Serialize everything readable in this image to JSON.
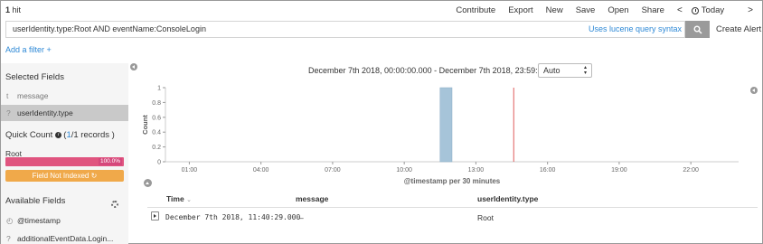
{
  "topbar": {
    "hit_count": "1",
    "hit_label": "hit",
    "menu": [
      "Contribute",
      "Export",
      "New",
      "Save",
      "Open",
      "Share"
    ],
    "nav_prev": "<",
    "today": "Today",
    "nav_next": ">"
  },
  "search": {
    "query": "userIdentity.type:Root AND eventName:ConsoleLogin",
    "lucene_link": "Uses lucene query syntax",
    "create_alert": "Create Alert"
  },
  "filters": {
    "add_filter": "Add a filter +"
  },
  "sidebar": {
    "selected_title": "Selected Fields",
    "selected_fields": [
      {
        "type": "t",
        "name": "message"
      },
      {
        "type": "?",
        "name": "userIdentity.type"
      }
    ],
    "quick_count": {
      "title": "Quick Count",
      "count_open": "(",
      "count_link": "1",
      "count_rest": "/1 records )",
      "value": "Root",
      "percent": "100.0%",
      "percent_value": 100,
      "field_not_indexed": "Field Not Indexed ↻"
    },
    "available_title": "Available Fields",
    "available_fields": [
      {
        "type": "◴",
        "name": "@timestamp"
      },
      {
        "type": "?",
        "name": "additionalEventData.Login..."
      }
    ]
  },
  "histogram": {
    "date_range": "December 7th 2018, 00:00:00.000 - December 7th 2018, 23:59:59.999 —",
    "interval": "Auto"
  },
  "chart_data": {
    "type": "bar",
    "ylabel": "Count",
    "xlabel": "@timestamp per 30 minutes",
    "x_tick_labels": [
      "01:00",
      "04:00",
      "07:00",
      "10:00",
      "13:00",
      "16:00",
      "19:00",
      "22:00"
    ],
    "y_ticks": [
      0,
      0.2,
      0.4,
      0.6,
      0.8,
      1
    ],
    "ylim": [
      0,
      1
    ],
    "bars": [
      {
        "x": "11:30",
        "value": 1
      }
    ],
    "current_time_marker": "14:35",
    "bar_color": "#a6c4d9",
    "marker_color": "#e05c5c"
  },
  "table": {
    "headers": [
      "Time",
      "message",
      "userIdentity.type"
    ],
    "sort_indicator": "⌄",
    "rows": [
      {
        "time": "December 7th 2018, 11:40:29.000",
        "message": "–",
        "type": "Root"
      }
    ]
  },
  "colors": {
    "link": "#2e89d6",
    "percent_bar": "#e0547f",
    "not_indexed": "#f0a94a",
    "selected_field_bg": "#c9c9c9"
  }
}
